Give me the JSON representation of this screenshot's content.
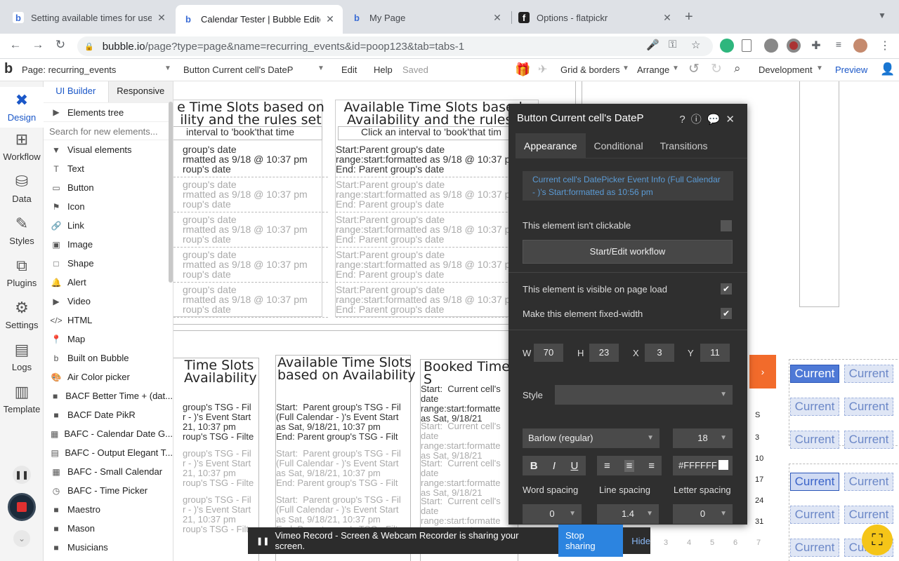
{
  "browser": {
    "tabs": [
      {
        "title": "Setting available times for use",
        "favicon": "b"
      },
      {
        "title": "Calendar Tester | Bubble Editor",
        "favicon": "b"
      },
      {
        "title": "My Page",
        "favicon": "b"
      },
      {
        "title": "Options - flatpickr",
        "favicon": "f"
      }
    ],
    "url_host": "bubble.io",
    "url_path": "/page?type=page&name=recurring_events&id=poop123&tab=tabs-1"
  },
  "appbar": {
    "page_label": "Page: recurring_events",
    "element_select": "Button Current cell's DateP",
    "edit": "Edit",
    "help": "Help",
    "saved": "Saved",
    "grid": "Grid & borders",
    "arrange": "Arrange",
    "env": "Development",
    "preview": "Preview"
  },
  "rail": [
    {
      "label": "Design",
      "icon": "design-icon"
    },
    {
      "label": "Workflow",
      "icon": "workflow-icon"
    },
    {
      "label": "Data",
      "icon": "database-icon"
    },
    {
      "label": "Styles",
      "icon": "brush-icon"
    },
    {
      "label": "Plugins",
      "icon": "plugin-icon"
    },
    {
      "label": "Settings",
      "icon": "gear-icon"
    },
    {
      "label": "Logs",
      "icon": "document-icon"
    },
    {
      "label": "Template",
      "icon": "template-icon"
    }
  ],
  "panel": {
    "tab_builder": "UI Builder",
    "tab_responsive": "Responsive",
    "elements_tree": "Elements tree",
    "search_placeholder": "Search for new elements...",
    "visual_elements": "Visual elements",
    "items": [
      {
        "label": "Text",
        "icon": "T"
      },
      {
        "label": "Button",
        "icon": "▭"
      },
      {
        "label": "Icon",
        "icon": "⚑"
      },
      {
        "label": "Link",
        "icon": "🔗"
      },
      {
        "label": "Image",
        "icon": "▣"
      },
      {
        "label": "Shape",
        "icon": "□"
      },
      {
        "label": "Alert",
        "icon": "🔔"
      },
      {
        "label": "Video",
        "icon": "▶"
      },
      {
        "label": "HTML",
        "icon": "</>"
      },
      {
        "label": "Map",
        "icon": "📍"
      },
      {
        "label": "Built on Bubble",
        "icon": "b"
      },
      {
        "label": "Air Color picker",
        "icon": "🎨"
      },
      {
        "label": "BACF Better Time + (dat...",
        "icon": "■"
      },
      {
        "label": "BACF Date PikR",
        "icon": "■"
      },
      {
        "label": "BAFC - Calendar Date G...",
        "icon": "▦"
      },
      {
        "label": "BAFC - Output Elegant T...",
        "icon": "▤"
      },
      {
        "label": "BAFC - Small Calendar",
        "icon": "▦"
      },
      {
        "label": "BAFC - Time Picker",
        "icon": "◷"
      },
      {
        "label": "Maestro",
        "icon": "■"
      },
      {
        "label": "Mason",
        "icon": "■"
      },
      {
        "label": "Musicians",
        "icon": "■"
      }
    ]
  },
  "canvas": {
    "title1": "e Time Slots based on\nility and the rules set",
    "title2": "Available Time Slots based o\nAvailability and the rules se",
    "click1": "interval to 'book'that time",
    "click2": "Click an interval to 'book'that tim",
    "row_a": "group's date\nrmatted as 9/18 @ 10:37 pm\nroup's date",
    "row_b": "Start:Parent group's date\nrange:start:formatted as 9/18 @ 10:37 p\nEnd: Parent group's date",
    "title3": "Time Slots\nAvailability",
    "title4": "Available Time Slots\nbased on Availability",
    "title5": "Booked Time S",
    "tsg_a": "group's TSG - Fil\nr - )'s Event Start\n21, 10:37 pm\nroup's TSG - Filte",
    "tsg_b": "Start:  Parent group's TSG - Fil\n(Full Calendar - )'s Event Start\nas Sat, 9/18/21, 10:37 pm\nEnd: Parent group's TSG - Filt",
    "booked": "Start:  Current cell's\ndate\nrange:start:formatte\nas Sat, 9/18/21",
    "current_label": "Current",
    "cal_days": [
      "S",
      "3",
      "10",
      "17",
      "24",
      "31"
    ],
    "cal_next": [
      "3",
      "4",
      "5",
      "6",
      "7"
    ]
  },
  "modal": {
    "title": "Button Current cell's DateP",
    "tabs": [
      "Appearance",
      "Conditional",
      "Transitions"
    ],
    "text_value": "Current cell's DatePicker Event Info (Full Calendar - )'s Start:formatted as 10:56 pm",
    "not_clickable": "This element isn't clickable",
    "workflow_btn": "Start/Edit workflow",
    "visible_load": "This element is visible on page load",
    "fixed_width": "Make this element fixed-width",
    "w_label": "W",
    "w": "70",
    "h_label": "H",
    "h": "23",
    "x_label": "X",
    "x": "3",
    "y_label": "Y",
    "y": "11",
    "style_label": "Style",
    "font": "Barlow (regular)",
    "font_size": "18",
    "color": "#FFFFFF",
    "word_spacing_label": "Word spacing",
    "line_spacing_label": "Line spacing",
    "letter_spacing_label": "Letter spacing",
    "word_spacing": "0",
    "line_spacing": "1.4",
    "letter_spacing": "0"
  },
  "vimeo": {
    "message": "Vimeo Record - Screen & Webcam Recorder is sharing your screen.",
    "stop": "Stop sharing",
    "hide": "Hide"
  },
  "colors": {
    "accent": "#1a57c8",
    "modal_bg": "#2f2f2f",
    "link_blue": "#5b9bd5",
    "orange": "#f26b2b"
  }
}
